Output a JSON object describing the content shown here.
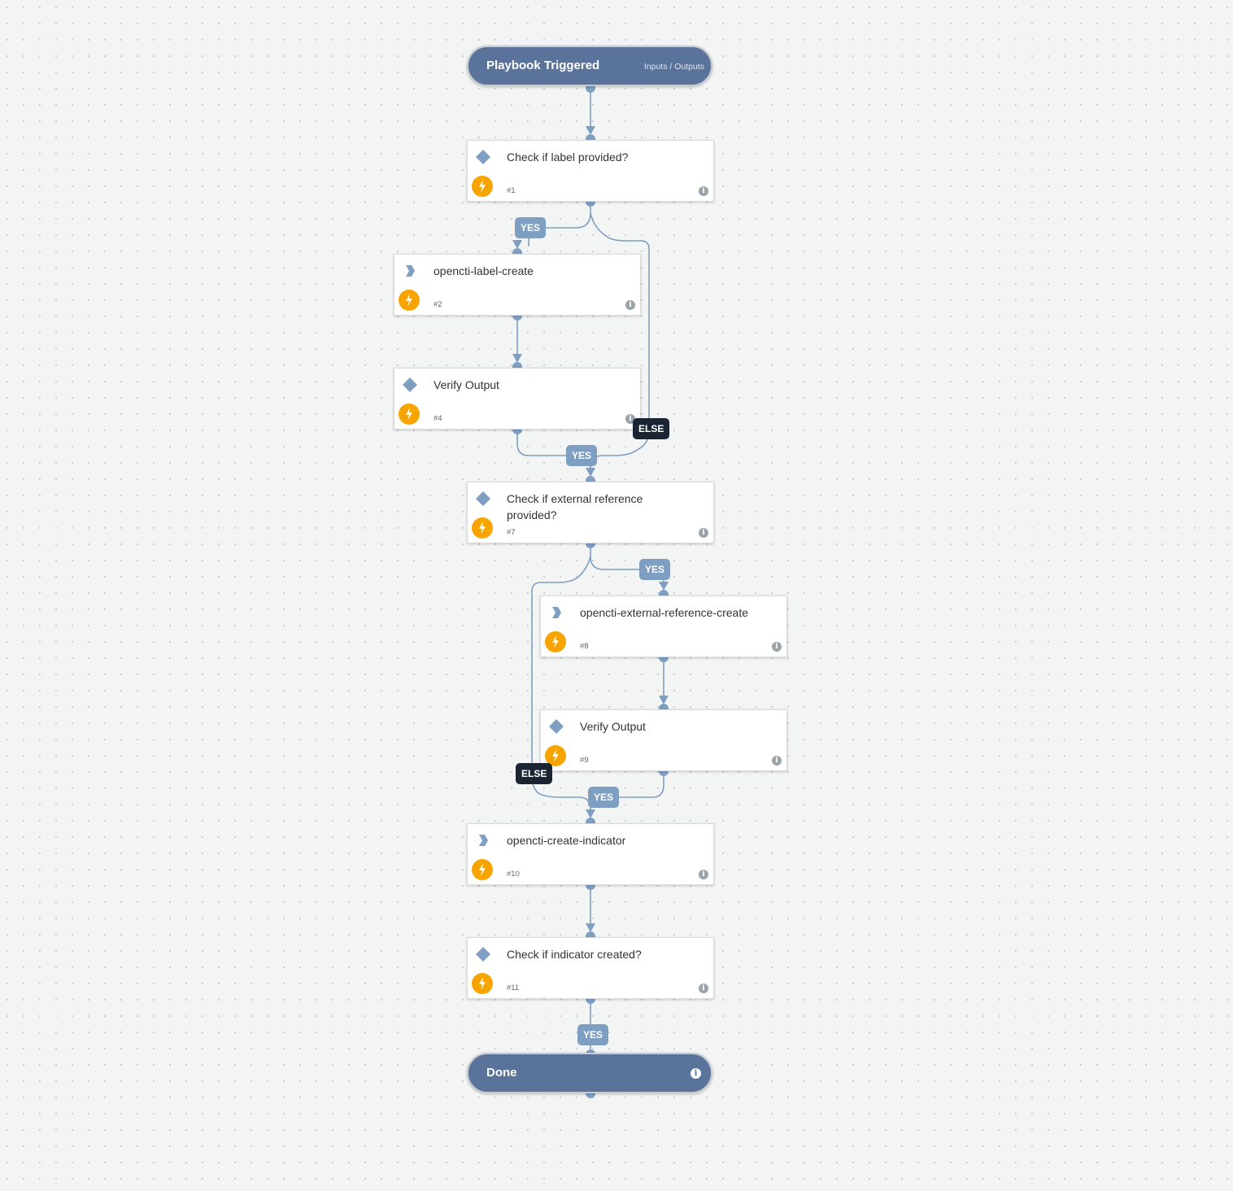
{
  "start": {
    "title": "Playbook Triggered",
    "io_label": "Inputs / Outputs"
  },
  "end": {
    "title": "Done",
    "info": "i"
  },
  "tasks": [
    {
      "id": "1",
      "name": "Check if label provided?",
      "number": "#1",
      "type": "condition"
    },
    {
      "id": "2",
      "name": "opencti-label-create",
      "number": "#2",
      "type": "command"
    },
    {
      "id": "4",
      "name": "Verify Output",
      "number": "#4",
      "type": "condition"
    },
    {
      "id": "7",
      "name": "Check if external reference provided?",
      "number": "#7",
      "type": "condition"
    },
    {
      "id": "8",
      "name": "opencti-external-reference-create",
      "number": "#8",
      "type": "command"
    },
    {
      "id": "9",
      "name": "Verify Output",
      "number": "#9",
      "type": "condition"
    },
    {
      "id": "10",
      "name": "opencti-create-indicator",
      "number": "#10",
      "type": "command"
    },
    {
      "id": "11",
      "name": "Check if indicator created?",
      "number": "#11",
      "type": "condition"
    }
  ],
  "badges": {
    "yes": "YES",
    "else": "ELSE"
  },
  "info_glyph": "i",
  "colors": {
    "edge": "#7f9fc2",
    "node_header": "#59739a",
    "yes_badge": "#7f9fc2",
    "else_badge": "#1a2433",
    "bolt": "#f7a400"
  }
}
